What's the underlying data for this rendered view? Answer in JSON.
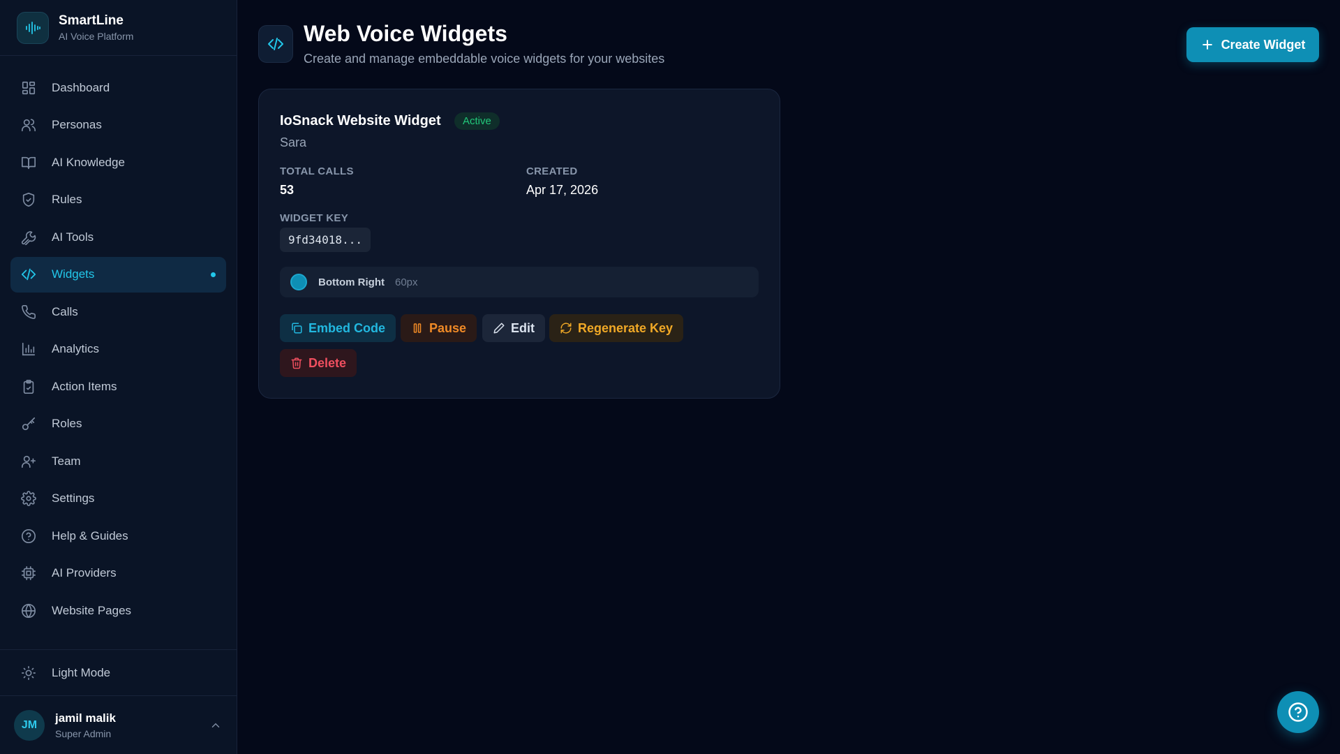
{
  "brand": {
    "name": "SmartLine",
    "subtitle": "AI Voice Platform"
  },
  "sidebar": {
    "items": [
      {
        "label": "Dashboard",
        "icon": "dashboard-icon"
      },
      {
        "label": "Personas",
        "icon": "users-icon"
      },
      {
        "label": "AI Knowledge",
        "icon": "book-icon"
      },
      {
        "label": "Rules",
        "icon": "shield-icon"
      },
      {
        "label": "AI Tools",
        "icon": "wrench-icon"
      },
      {
        "label": "Widgets",
        "icon": "code-icon",
        "active": true
      },
      {
        "label": "Calls",
        "icon": "phone-icon"
      },
      {
        "label": "Analytics",
        "icon": "bar-chart-icon"
      },
      {
        "label": "Action Items",
        "icon": "clipboard-icon"
      },
      {
        "label": "Roles",
        "icon": "key-icon"
      },
      {
        "label": "Team",
        "icon": "user-plus-icon"
      },
      {
        "label": "Settings",
        "icon": "gear-icon"
      },
      {
        "label": "Help & Guides",
        "icon": "help-circle-icon"
      },
      {
        "label": "AI Providers",
        "icon": "cpu-icon"
      },
      {
        "label": "Website Pages",
        "icon": "globe-icon"
      }
    ],
    "light_mode_label": "Light Mode"
  },
  "user": {
    "initials": "JM",
    "name": "jamil malik",
    "role": "Super Admin"
  },
  "header": {
    "title": "Web Voice Widgets",
    "subtitle": "Create and manage embeddable voice widgets for your websites",
    "create_button": "Create Widget"
  },
  "widget": {
    "name": "IoSnack Website Widget",
    "status": "Active",
    "persona": "Sara",
    "total_calls_label": "TOTAL CALLS",
    "total_calls": "53",
    "created_label": "CREATED",
    "created": "Apr 17, 2026",
    "key_label": "WIDGET KEY",
    "key": "9fd34018...",
    "position": "Bottom Right",
    "size": "60px",
    "actions": {
      "embed": "Embed Code",
      "pause": "Pause",
      "edit": "Edit",
      "regenerate": "Regenerate Key",
      "delete": "Delete"
    }
  },
  "colors": {
    "background": "#040919",
    "sidebar": "#0a1426",
    "accent": "#0e8fb5",
    "active_text": "#22c7ea",
    "status_green": "#22c87a",
    "pause_orange": "#f08a26",
    "delete_red": "#ef4f5f"
  }
}
